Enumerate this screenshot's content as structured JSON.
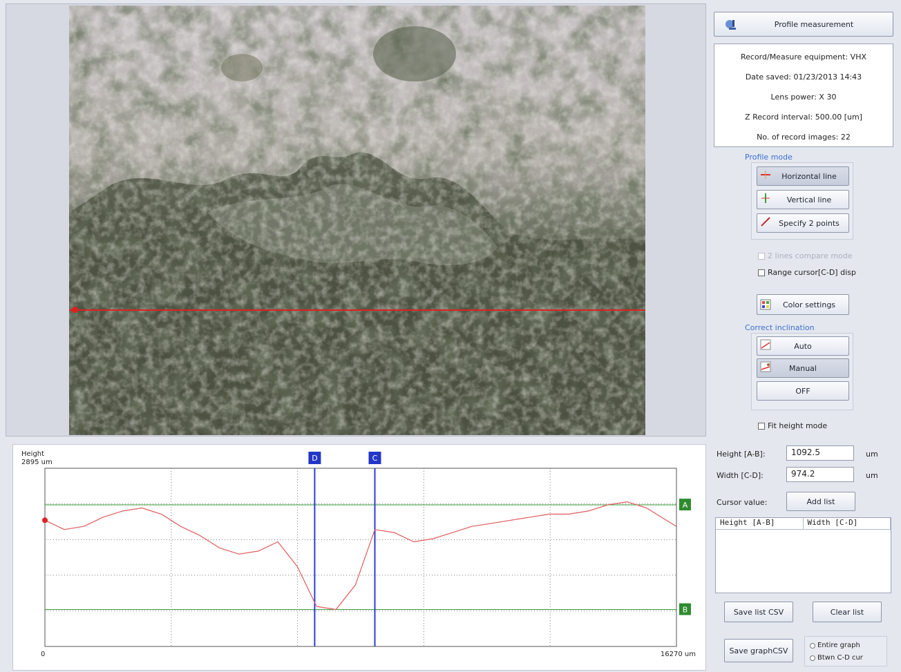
{
  "header": {
    "title": "Profile measurement"
  },
  "info": {
    "equipment": "Record/Measure equipment: VHX",
    "date_saved": "Date saved: 01/23/2013 14:43",
    "lens_power": "Lens power: X 30",
    "z_interval": "Z Record interval: 500.00 [um]",
    "num_images": "No. of record images: 22"
  },
  "profile_mode": {
    "label": "Profile mode",
    "horizontal": "Horizontal line",
    "vertical": "Vertical line",
    "two_points": "Specify 2 points"
  },
  "options": {
    "lines_compare": "2 lines compare mode",
    "range_cursor": "Range cursor[C-D] disp",
    "color_settings": "Color settings",
    "fit_height": "Fit height mode"
  },
  "inclination": {
    "label": "Correct inclination",
    "auto": "Auto",
    "manual": "Manual",
    "off": "OFF"
  },
  "measure": {
    "height_label": "Height [A-B]:",
    "height_value": "1092.5",
    "height_unit": "um",
    "width_label": "Width [C-D]:",
    "width_value": "974.2",
    "width_unit": "um",
    "cursor_label": "Cursor value:",
    "add_list": "Add list",
    "list_headers": [
      "Height [A-B]",
      "Width [C-D]"
    ],
    "save_list_csv": "Save list CSV",
    "clear_list": "Clear list",
    "save_graph_csv": "Save graphCSV",
    "radio_entire": "Entire graph",
    "radio_between": "Btwn C-D cur"
  },
  "colors": {
    "profile_line": "#e05a5a",
    "cursor_blue": "#2a3dd6",
    "cursor_green": "#3a9c3a",
    "red_line": "#e02020"
  },
  "chart_data": {
    "type": "line",
    "ylabel": "Height",
    "ylabel_value": "2895 um",
    "x_start_label": "0",
    "x_end_label": "16270 um",
    "xlim": [
      0,
      16270
    ],
    "ylim": [
      0,
      2895
    ],
    "series": [
      {
        "x": [
          0,
          500,
          1000,
          1500,
          2000,
          2500,
          3000,
          3500,
          4000,
          4500,
          5000,
          5500,
          6000,
          6500,
          7000,
          7500,
          8000,
          8500,
          9000,
          9500,
          10000,
          10500,
          11000,
          11500,
          12000,
          12500,
          13000,
          13500,
          14000,
          14500,
          15000,
          15500,
          16270
        ],
        "values": [
          2050,
          1900,
          1950,
          2100,
          2200,
          2250,
          2150,
          1950,
          1800,
          1600,
          1500,
          1550,
          1700,
          1300,
          650,
          600,
          1000,
          1900,
          1850,
          1700,
          1750,
          1850,
          1950,
          2000,
          2050,
          2100,
          2150,
          2150,
          2200,
          2300,
          2350,
          2250,
          1950
        ]
      }
    ],
    "cursors": {
      "A": 2300,
      "B": 600,
      "C": 8500,
      "D": 6950
    }
  }
}
